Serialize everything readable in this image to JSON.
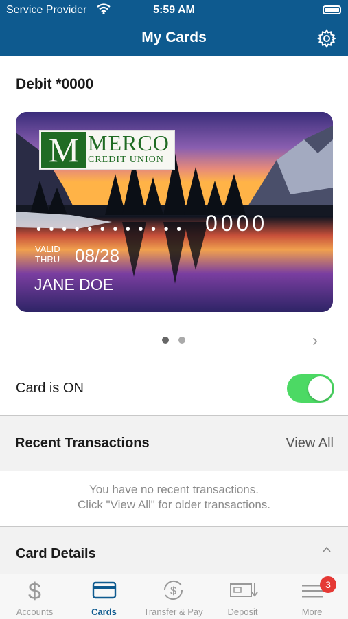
{
  "status_bar": {
    "carrier": "Service Provider",
    "time": "5:59 AM"
  },
  "nav": {
    "title": "My Cards"
  },
  "card": {
    "title": "Debit *0000",
    "brand_main": "MERCO",
    "brand_letter": "M",
    "brand_sub": "CREDIT UNION",
    "masked_dots": "• • • •   • • • •   • • • •",
    "last4": "0000",
    "valid_line1": "VALID",
    "valid_line2": "THRU",
    "expiry": "08/28",
    "holder": "JANE DOE"
  },
  "pager": {
    "count": 2,
    "active_index": 0
  },
  "toggle": {
    "label": "Card is ON",
    "on": true
  },
  "recent": {
    "title": "Recent Transactions",
    "view_all": "View All",
    "empty_line1": "You have no recent transactions.",
    "empty_line2": "Click \"View All\" for older transactions."
  },
  "details": {
    "title": "Card Details"
  },
  "tabs": [
    {
      "label": "Accounts",
      "icon": "dollar-icon",
      "active": false
    },
    {
      "label": "Cards",
      "icon": "card-icon",
      "active": true
    },
    {
      "label": "Transfer & Pay",
      "icon": "transfer-icon",
      "active": false
    },
    {
      "label": "Deposit",
      "icon": "deposit-icon",
      "active": false
    },
    {
      "label": "More",
      "icon": "menu-icon",
      "active": false
    }
  ],
  "more_badge": "3",
  "colors": {
    "brand_blue": "#0e5a8f",
    "toggle_green": "#4cd964",
    "badge_red": "#e53935"
  }
}
